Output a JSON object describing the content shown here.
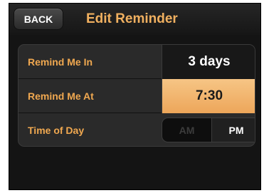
{
  "header": {
    "back_label": "BACK",
    "title": "Edit Reminder"
  },
  "rows": [
    {
      "label": "Remind Me In",
      "value": "3 days"
    },
    {
      "label": "Remind Me At",
      "value": "7:30"
    },
    {
      "label": "Time of Day"
    }
  ],
  "time_of_day": {
    "options": [
      "AM",
      "PM"
    ],
    "selected": "PM"
  },
  "colors": {
    "accent": "#f0a850",
    "highlight": "#eda65a",
    "background": "#141414"
  }
}
